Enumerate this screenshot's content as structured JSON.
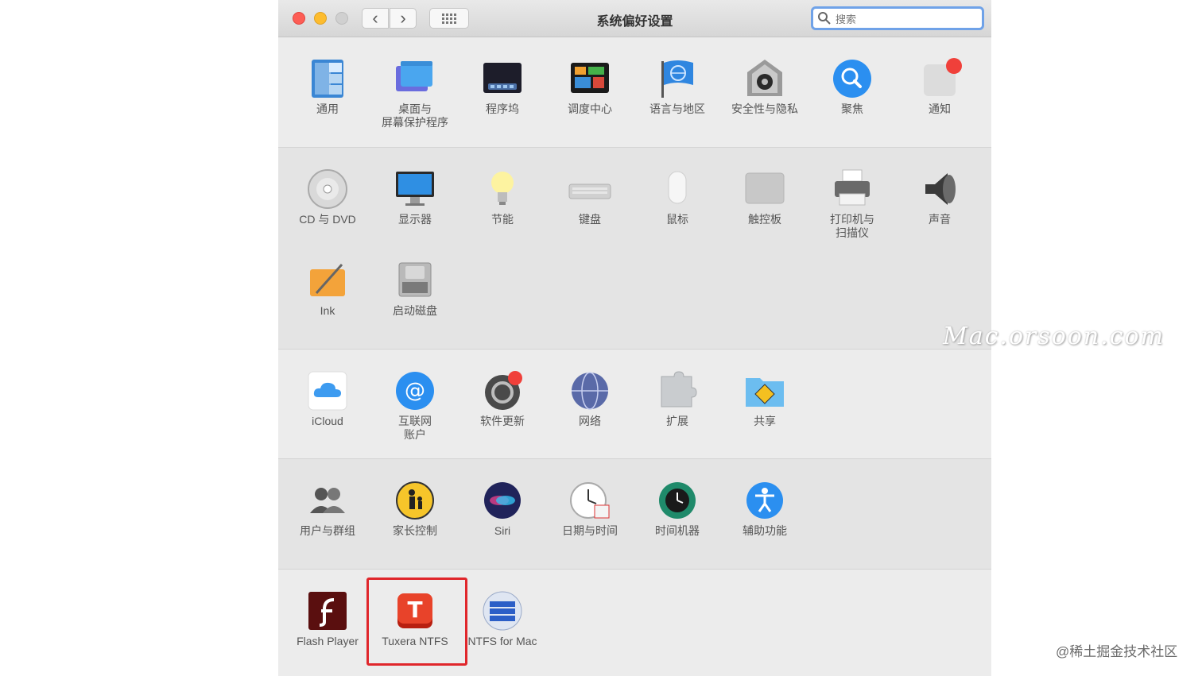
{
  "window": {
    "title": "系统偏好设置",
    "search_placeholder": "搜索"
  },
  "rows": {
    "row1": [
      {
        "label": "通用",
        "icon": "general-icon"
      },
      {
        "label": "桌面与\n屏幕保护程序",
        "icon": "desktop-screensaver-icon"
      },
      {
        "label": "程序坞",
        "icon": "dock-icon"
      },
      {
        "label": "调度中心",
        "icon": "mission-control-icon"
      },
      {
        "label": "语言与地区",
        "icon": "language-region-icon"
      },
      {
        "label": "安全性与隐私",
        "icon": "security-privacy-icon"
      },
      {
        "label": "聚焦",
        "icon": "spotlight-icon"
      },
      {
        "label": "通知",
        "icon": "notifications-icon"
      }
    ],
    "row2": [
      {
        "label": "CD 与 DVD",
        "icon": "cd-dvd-icon"
      },
      {
        "label": "显示器",
        "icon": "displays-icon"
      },
      {
        "label": "节能",
        "icon": "energy-saver-icon"
      },
      {
        "label": "键盘",
        "icon": "keyboard-icon"
      },
      {
        "label": "鼠标",
        "icon": "mouse-icon"
      },
      {
        "label": "触控板",
        "icon": "trackpad-icon"
      },
      {
        "label": "打印机与\n扫描仪",
        "icon": "printers-scanners-icon"
      },
      {
        "label": "声音",
        "icon": "sound-icon"
      }
    ],
    "row2b": [
      {
        "label": "Ink",
        "icon": "ink-icon"
      },
      {
        "label": "启动磁盘",
        "icon": "startup-disk-icon"
      }
    ],
    "row3": [
      {
        "label": "iCloud",
        "icon": "icloud-icon"
      },
      {
        "label": "互联网\n账户",
        "icon": "internet-accounts-icon"
      },
      {
        "label": "软件更新",
        "icon": "software-update-icon",
        "badge": "1"
      },
      {
        "label": "网络",
        "icon": "network-icon"
      },
      {
        "label": "扩展",
        "icon": "extensions-icon"
      },
      {
        "label": "共享",
        "icon": "sharing-icon"
      }
    ],
    "row4": [
      {
        "label": "用户与群组",
        "icon": "users-groups-icon"
      },
      {
        "label": "家长控制",
        "icon": "parental-controls-icon"
      },
      {
        "label": "Siri",
        "icon": "siri-icon"
      },
      {
        "label": "日期与时间",
        "icon": "date-time-icon"
      },
      {
        "label": "时间机器",
        "icon": "time-machine-icon"
      },
      {
        "label": "辅助功能",
        "icon": "accessibility-icon"
      }
    ],
    "row5": [
      {
        "label": "Flash Player",
        "icon": "flash-player-icon"
      },
      {
        "label": "Tuxera NTFS",
        "icon": "tuxera-ntfs-icon"
      },
      {
        "label": "NTFS for Mac",
        "icon": "ntfs-for-mac-icon"
      }
    ]
  },
  "overlay": {
    "watermark": "Mac.orsoon.com",
    "credit": "@稀土掘金技术社区"
  },
  "colors": {
    "highlight": "#e0262b",
    "search_focus": "#6fa2e8",
    "badge_red": "#f0403a"
  }
}
